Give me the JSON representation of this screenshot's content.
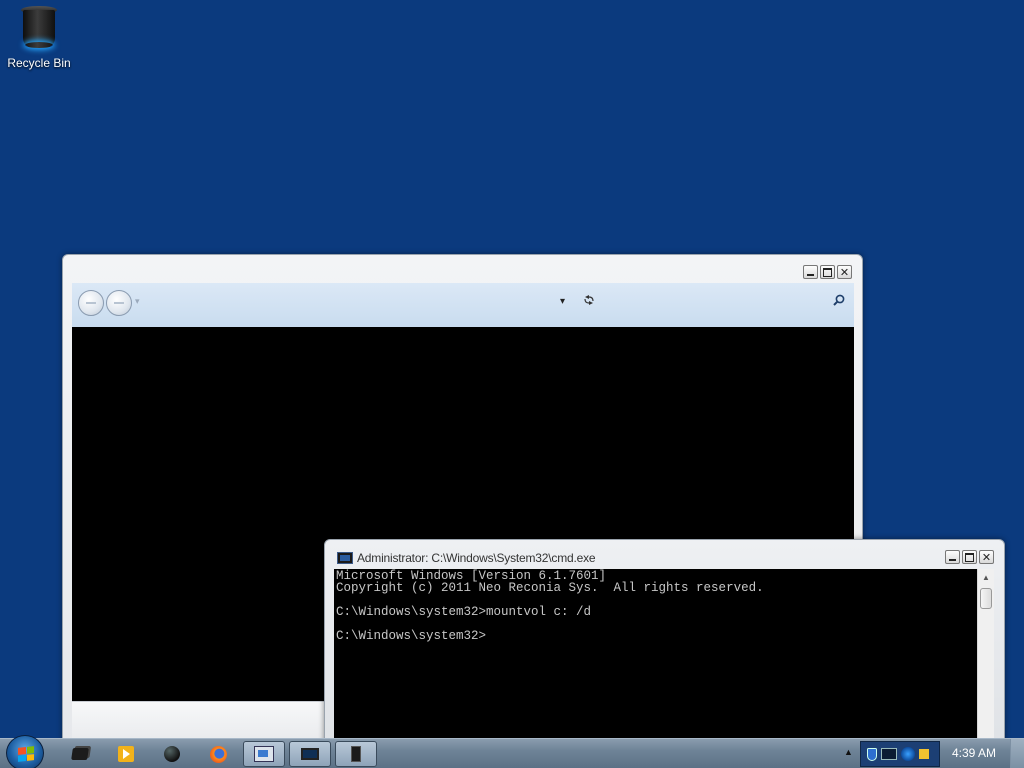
{
  "desktop": {
    "background": "#0b3a7e",
    "icons": [
      {
        "label": "Recycle Bin",
        "icon": "recycle-bin-icon"
      }
    ]
  },
  "explorer": {
    "caption_buttons": [
      "minimize",
      "maximize",
      "close"
    ],
    "close_glyph": "✕",
    "nav_dropdown_glyph": "▾",
    "address_dropdown_glyph": "▾",
    "icons": [
      "back-icon",
      "forward-icon",
      "refresh-icon",
      "search-icon"
    ]
  },
  "cmd": {
    "title": "Administrator: C:\\Windows\\System32\\cmd.exe",
    "close_glyph": "✕",
    "scroll_up_glyph": "▲",
    "lines": [
      "Microsoft Windows [Version 6.1.7601]",
      "Copyright (c) 2011 Neo Reconia Sys.  All rights reserved.",
      "",
      "C:\\Windows\\system32>mountvol c: /d",
      "",
      "C:\\Windows\\system32>"
    ]
  },
  "taskbar": {
    "start_icon": "windows-logo-icon",
    "buttons": [
      {
        "icon": "folder-icon",
        "active": false
      },
      {
        "icon": "media-player-icon",
        "active": false
      },
      {
        "icon": "ball-icon",
        "active": false
      },
      {
        "icon": "firefox-icon",
        "active": false
      },
      {
        "icon": "control-panel-icon",
        "active": true
      },
      {
        "icon": "monitor-icon",
        "active": true
      },
      {
        "icon": "computer-tower-icon",
        "active": true
      }
    ],
    "tray_arrow": "▲",
    "tray_icons": [
      "shield-icon",
      "screen-icon",
      "network-icon",
      "volume-icon"
    ],
    "clock": "4:39 AM"
  }
}
